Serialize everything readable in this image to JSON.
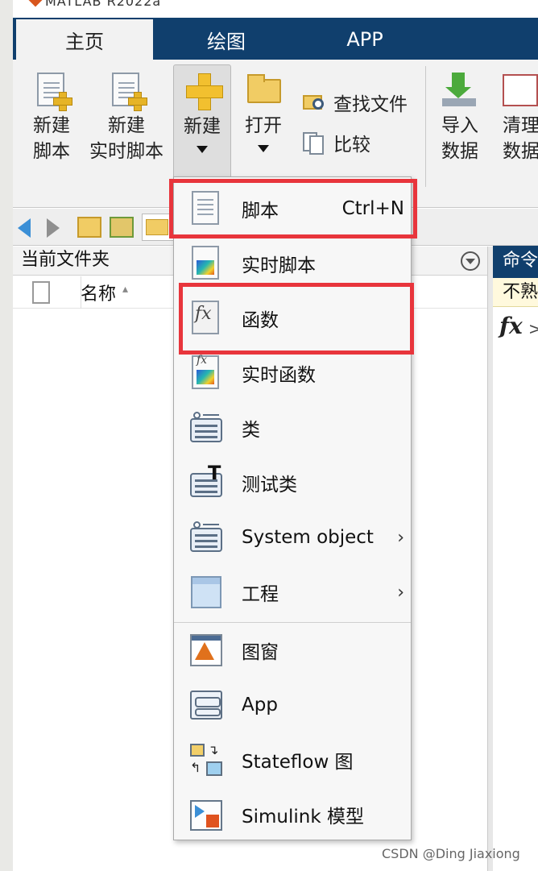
{
  "window": {
    "title": "MATLAB R2022a"
  },
  "tabs": [
    {
      "label": "主页"
    },
    {
      "label": "绘图"
    },
    {
      "label": "APP"
    }
  ],
  "ribbon": {
    "new_script": "新建\n脚本",
    "new_live_script": "新建\n实时脚本",
    "new": "新建",
    "open": "打开",
    "find_files": "查找文件",
    "compare": "比较",
    "import_data": "导入\n数据",
    "clean_data": "清理\n数据"
  },
  "file_panel": {
    "title": "当前文件夹",
    "name_col": "名称",
    "sort_indicator": "▴"
  },
  "command_window": {
    "title": "命令行窗口",
    "info": "不熟悉 MATLAB?",
    "prompt_icon": "fx",
    "prompt": ">>"
  },
  "new_menu": {
    "items": [
      {
        "label": "脚本",
        "shortcut": "Ctrl+N",
        "icon": "script-icon",
        "highlighted": true
      },
      {
        "label": "实时脚本",
        "icon": "live-script-icon"
      },
      {
        "label": "函数",
        "icon": "function-icon",
        "highlighted": true
      },
      {
        "label": "实时函数",
        "icon": "live-function-icon"
      },
      {
        "label": "类",
        "icon": "class-icon"
      },
      {
        "label": "测试类",
        "icon": "test-class-icon"
      },
      {
        "label": "System object",
        "icon": "system-object-icon",
        "submenu": true
      },
      {
        "label": "工程",
        "icon": "project-icon",
        "submenu": true
      },
      {
        "label": "图窗",
        "icon": "figure-icon"
      },
      {
        "label": "App",
        "icon": "app-icon"
      },
      {
        "label": "Stateflow 图",
        "icon": "stateflow-icon"
      },
      {
        "label": "Simulink 模型",
        "icon": "simulink-icon"
      }
    ],
    "submenu_glyph": "›"
  },
  "highlight_color": "#e8353c",
  "accent_color": "#103f6d",
  "watermark": "CSDN @Ding Jiaxiong"
}
